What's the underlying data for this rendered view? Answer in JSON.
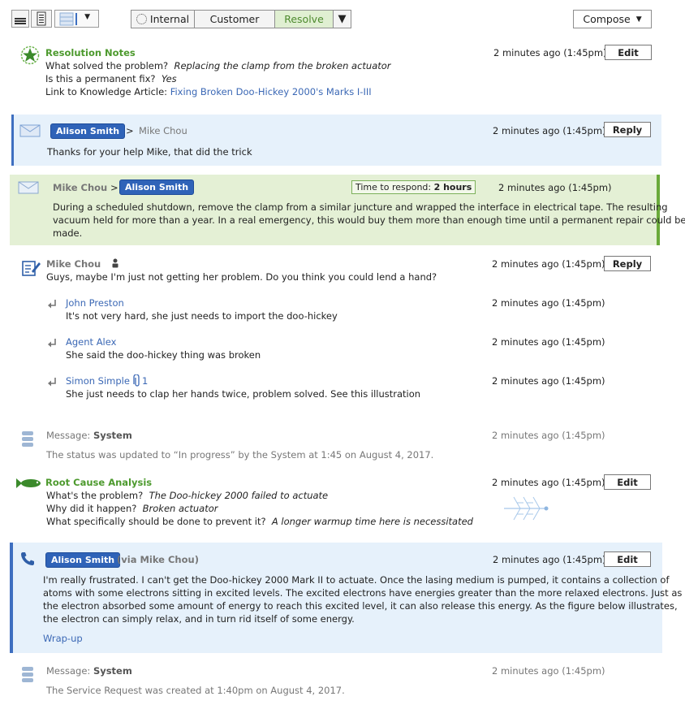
{
  "toolbar": {
    "filters": {
      "internal": "Internal",
      "customer": "Customer",
      "resolve": "Resolve"
    },
    "compose_label": "Compose"
  },
  "resolution": {
    "title": "Resolution Notes",
    "time": "2 minutes ago (1:45pm)",
    "edit_label": "Edit",
    "q1": "What solved the problem?",
    "a1": "Replacing the clamp from the broken actuator",
    "q2": "Is this a permanent fix?",
    "a2": "Yes",
    "q3": "Link to Knowledge Article:",
    "a3": "Fixing Broken Doo-Hickey 2000's Marks I-III"
  },
  "email1": {
    "from": "Alison Smith",
    "arrow": ">",
    "to": "Mike Chou",
    "time": "2 minutes ago (1:45pm)",
    "reply_label": "Reply",
    "body": "Thanks for your help Mike, that did the trick"
  },
  "email2": {
    "from": "Mike Chou",
    "arrow": ">",
    "to": "Alison Smith",
    "respond_label": "Time to respond:",
    "respond_value": "2 hours",
    "time": "2 minutes ago (1:45pm)",
    "body_l1": "During a scheduled shutdown, remove the clamp from a similar juncture and wrapped the interface in electrical tape. The resulting",
    "body_l2": "vacuum held for more than a year. In a real emergency, this would buy them more than enough time until a permanent repair could be",
    "body_l3": "made."
  },
  "note": {
    "author": "Mike Chou",
    "time": "2 minutes ago (1:45pm)",
    "reply_label": "Reply",
    "body": "Guys, maybe I'm just not getting her problem. Do you think you could lend a hand?",
    "replies": [
      {
        "author": "John Preston",
        "time": "2 minutes ago (1:45pm)",
        "body": "It's not very hard, she just needs to import the doo-hickey"
      },
      {
        "author": "Agent Alex",
        "time": "2 minutes ago (1:45pm)",
        "body": "She said the doo-hickey thing was broken"
      },
      {
        "author": "Simon Simple",
        "attachments": "1",
        "time": "2 minutes ago (1:45pm)",
        "body": "She just needs to clap her hands twice, problem solved. See this illustration"
      }
    ]
  },
  "system1": {
    "label": "Message:",
    "source": "System",
    "time": "2 minutes ago (1:45pm)",
    "body": "The status was updated to “In progress” by the System at 1:45 on August 4, 2017."
  },
  "rca": {
    "title": "Root Cause Analysis",
    "time": "2 minutes ago (1:45pm)",
    "edit_label": "Edit",
    "q1": "What's the problem?",
    "a1": "The Doo-hickey 2000 failed to actuate",
    "q2": "Why did it happen?",
    "a2": "Broken actuator",
    "q3": "What specifically should be done to prevent it?",
    "a3": "A longer warmup time here is necessitated"
  },
  "call": {
    "from": "Alison Smith",
    "via": "(via Mike Chou)",
    "time": "2 minutes ago (1:45pm)",
    "edit_label": "Edit",
    "body_l1": "I'm really frustrated. I can't get the Doo-hickey 2000 Mark II to actuate. Once the lasing medium is pumped, it contains a collection of",
    "body_l2": "atoms with some electrons sitting in excited levels. The excited electrons have energies greater than the more relaxed electrons. Just as",
    "body_l3": "the electron absorbed some amount of energy to reach this excited level, it can also release this energy. As the figure below illustrates,",
    "body_l4": "the electron can simply relax, and in turn rid itself of some energy.",
    "wrap_label": "Wrap-up"
  },
  "system2": {
    "label": "Message:",
    "source": "System",
    "time": "2 minutes ago (1:45pm)",
    "body": "The Service Request was created at 1:40pm on August 4, 2017."
  },
  "colors": {
    "accent_blue": "#2f63b8",
    "panel_blue": "#e6f1fb",
    "panel_green": "#e4f0d5",
    "green_text": "#4d9a2e",
    "border_blue": "#3e6fc0",
    "border_green": "#6aaa3a"
  }
}
